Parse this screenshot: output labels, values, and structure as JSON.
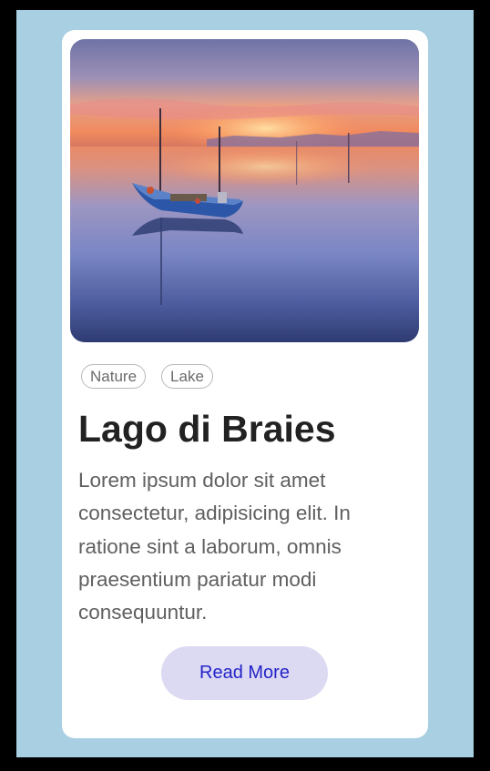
{
  "card": {
    "image": {
      "subject": "boat-on-lake-at-sunset"
    },
    "tags": [
      "Nature",
      "Lake"
    ],
    "title": "Lago di Braies",
    "description": "Lorem ipsum dolor sit amet consectetur, adipisicing elit. In ratione sint a laborum, omnis praesentium pariatur modi consequuntur.",
    "button_label": "Read More"
  },
  "colors": {
    "page_background": "#a9cfe3",
    "card_background": "#ffffff",
    "button_background": "#dcd9f2",
    "button_text": "#2323c9",
    "title_text": "#222222",
    "body_text": "#5f5f5f"
  }
}
